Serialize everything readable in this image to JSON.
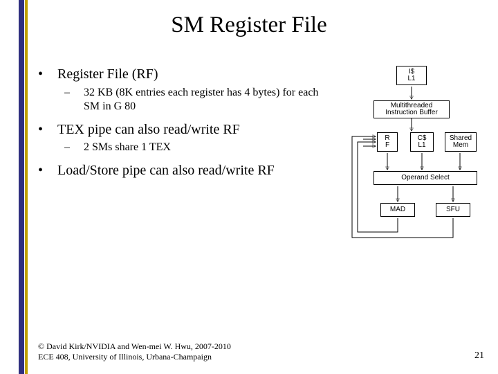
{
  "title": "SM Register File",
  "bullets": {
    "b1": "Register File (RF)",
    "b1a": "32 KB (8K entries each register has 4 bytes) for each SM in G 80",
    "b2": "TEX pipe can also read/write RF",
    "b2a": "2 SMs share 1 TEX",
    "b3": "Load/Store pipe can also read/write RF"
  },
  "diagram": {
    "icache": "I$\nL1",
    "ibuf": "Multithreaded\nInstruction Buffer",
    "rf": "R\nF",
    "ccache": "C$\nL1",
    "shmem": "Shared\nMem",
    "opsel": "Operand Select",
    "mad": "MAD",
    "sfu": "SFU"
  },
  "footer": {
    "line1": "© David Kirk/NVIDIA and Wen-mei W. Hwu, 2007-2010",
    "line2": "ECE 408, University of Illinois, Urbana-Champaign"
  },
  "pagenum": "21"
}
